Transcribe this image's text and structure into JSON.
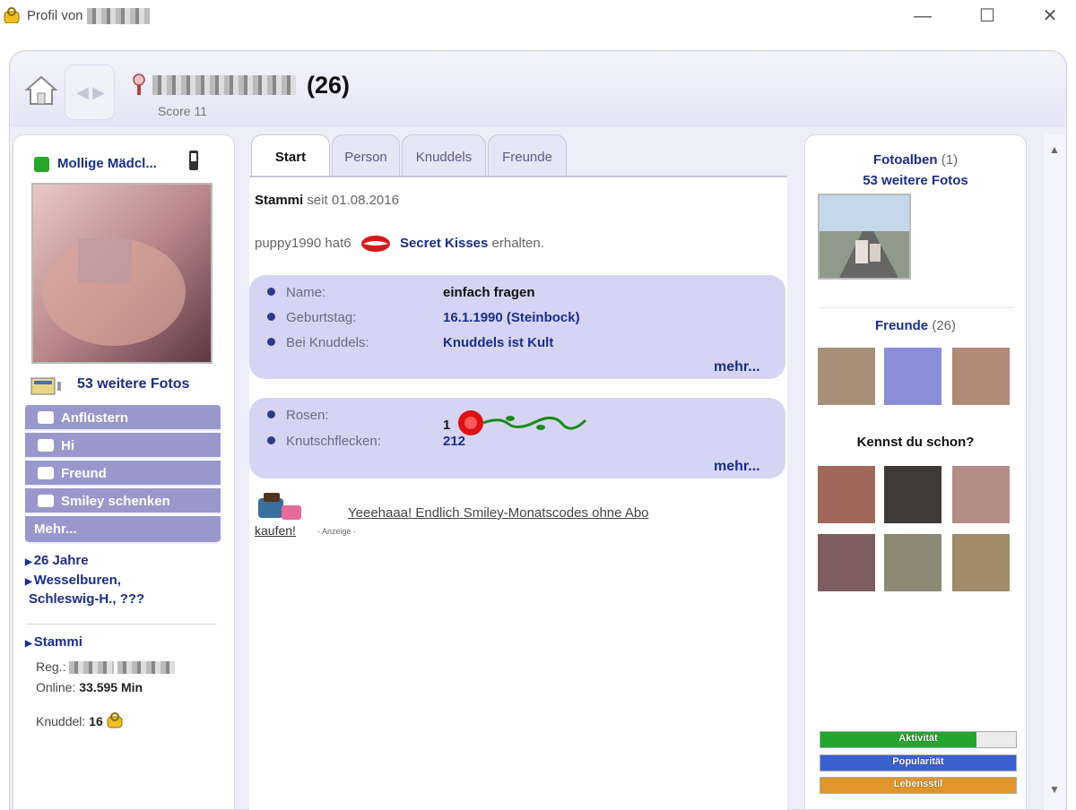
{
  "window": {
    "title": "Profil von",
    "minimize_glyph": "—",
    "maximize_glyph": "☐",
    "close_glyph": "✕"
  },
  "header": {
    "age": "(26)",
    "subtitle": "Score 11"
  },
  "left": {
    "status_name": "Mollige Mädcl...",
    "more_photos": "53 weitere Fotos",
    "actions": [
      {
        "label": "Anflüstern",
        "icon": "envelope-icon"
      },
      {
        "label": "Hi",
        "icon": "heart-icon"
      },
      {
        "label": "Freund",
        "icon": "plus-icon"
      },
      {
        "label": "Smiley schenken",
        "icon": "smiley-icon"
      }
    ],
    "more_label": "Mehr...",
    "age_line": "26 Jahre",
    "location_line1": "Wesselburen,",
    "location_line2": "Schleswig-H., ???",
    "stammi": "Stammi",
    "reg_label": "Reg.:",
    "online_label": "Online:",
    "online_value": "33.595 Min",
    "knuddel_label": "Knuddel:",
    "knuddel_value": "16"
  },
  "tabs": [
    "Start",
    "Person",
    "Knuddels",
    "Freunde"
  ],
  "center": {
    "stammi_label": "Stammi",
    "stammi_since": "seit 01.08.2016",
    "kiss_user": "puppy1990 hat",
    "kiss_count": "6",
    "kiss_label": "Secret Kisses",
    "kiss_suffix": "erhalten.",
    "info_rows": [
      {
        "label": "Name:",
        "value": "einfach fragen"
      },
      {
        "label": "Geburtstag:",
        "value": "16.1.1990 (Steinbock)"
      },
      {
        "label": "Bei Knuddels:",
        "value": "Knuddels ist Kult"
      }
    ],
    "stats_rows": [
      {
        "label": "Rosen:",
        "value": "1"
      },
      {
        "label": "Knutschflecken:",
        "value": "212"
      }
    ],
    "more": "mehr...",
    "ad_text": "Yeeehaaa! Endlich Smiley-Monatscodes ohne Abo",
    "ad_text2": "kaufen!",
    "ad_tag": "- Anzeige -"
  },
  "right": {
    "albums_title": "Fotoalben",
    "albums_count": "(1)",
    "albums_more": "53 weitere Fotos",
    "friends_title": "Freunde",
    "friends_count": "(26)",
    "suggest_title": "Kennst du schon?",
    "meters": [
      {
        "label": "Aktivität",
        "value": 0.8,
        "color": "#22a62e"
      },
      {
        "label": "Popularität",
        "value": 1.0,
        "color": "#3a5fcf"
      },
      {
        "label": "Lebensstil",
        "value": 1.0,
        "color": "#e0962a"
      }
    ]
  },
  "scroll": {
    "up": "▲",
    "down": "▼"
  }
}
